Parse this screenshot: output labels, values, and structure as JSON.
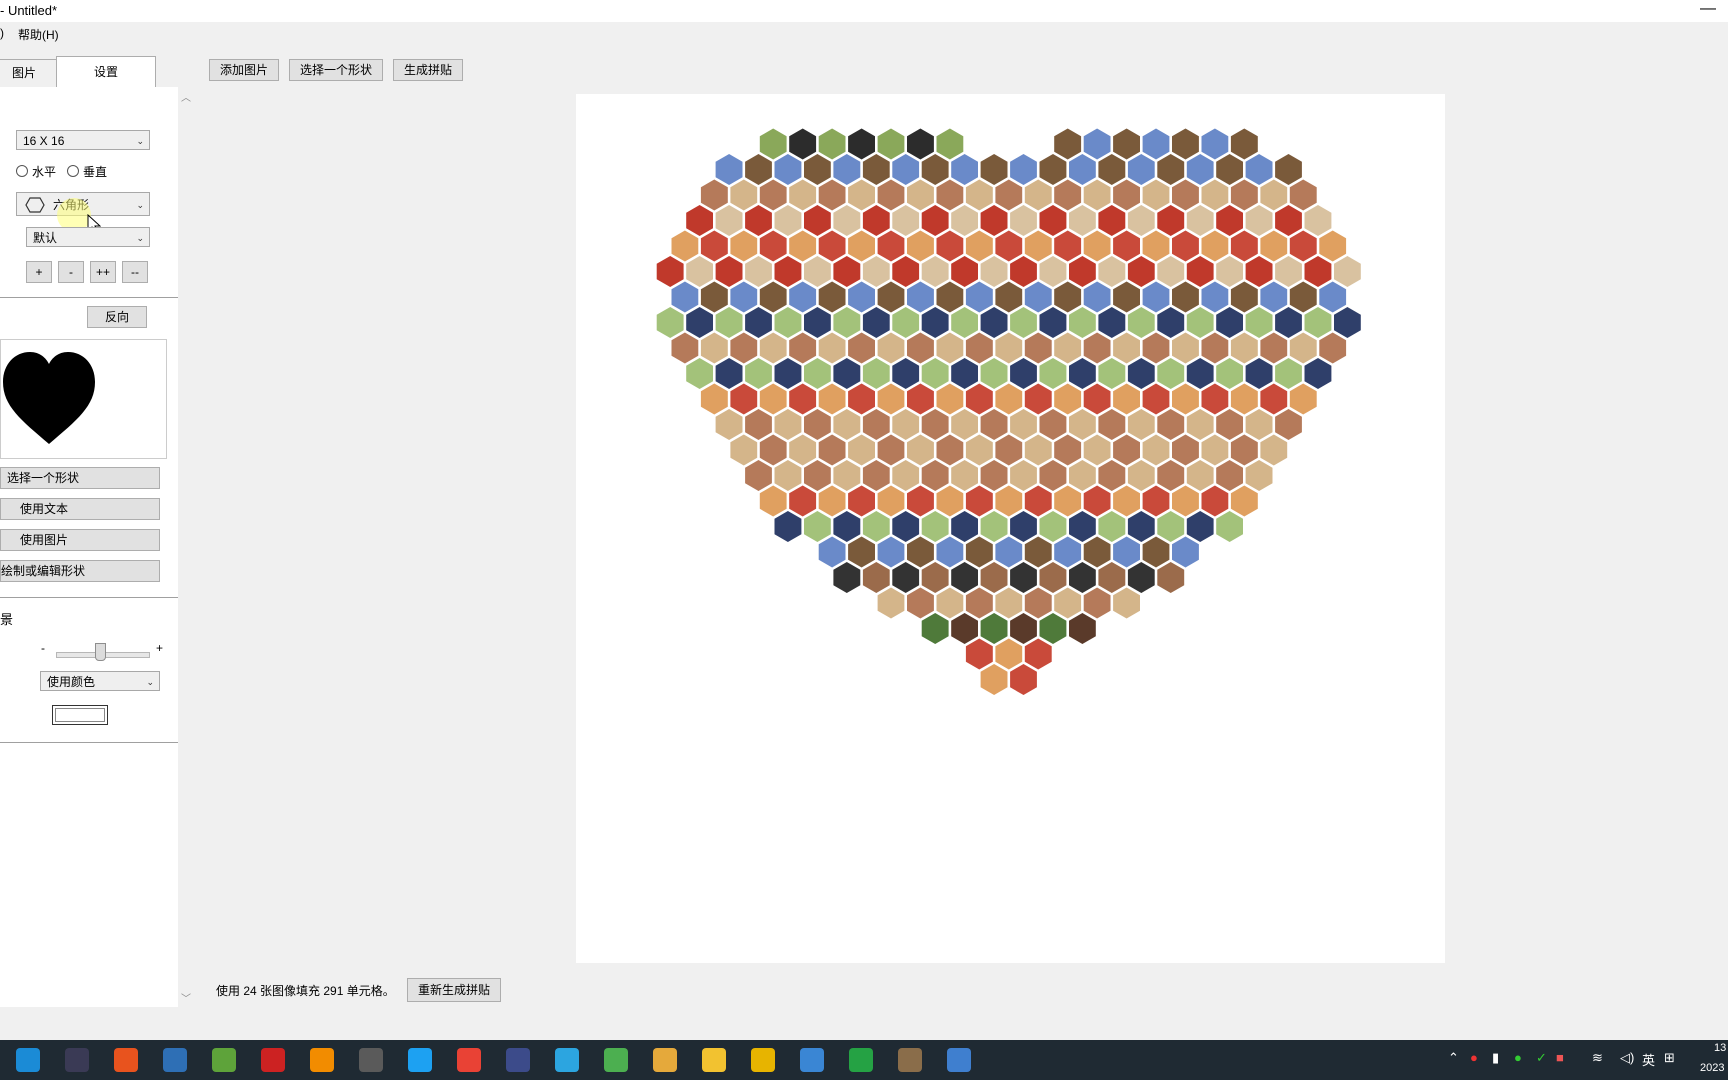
{
  "window": {
    "title": "- Untitled*",
    "minimize_glyph": "—"
  },
  "menu": {
    "items": [
      ")",
      "帮助(H)"
    ]
  },
  "tabs": [
    {
      "label": "图片"
    },
    {
      "label": "设置"
    }
  ],
  "settings": {
    "grid_size": "16 X 16",
    "orientation": {
      "horizontal": "水平",
      "vertical": "垂直"
    },
    "cell_shape": "六角形",
    "style": "默认",
    "size_buttons": [
      "+",
      "-",
      "++",
      "--"
    ],
    "reverse_label": "反向",
    "shape_buttons": [
      "选择一个形状",
      "使用文本",
      "使用图片",
      "绘制或编辑形状"
    ],
    "background_label": "景",
    "slider": {
      "minus": "-",
      "plus": "+",
      "level": 0.5
    },
    "fill_mode": "使用颜色",
    "background_color": "#ffffff"
  },
  "toolbar": {
    "add_images": "添加图片",
    "choose_shape": "选择一个形状",
    "generate": "生成拼贴"
  },
  "canvas": {
    "shape": "heart",
    "cell": "hexagon",
    "hex_cells": 291
  },
  "status": {
    "text": "使用 24 张图像填充 291 单元格。",
    "regenerate": "重新生成拼贴"
  },
  "taskbar": {
    "tray_ime": "英",
    "time": "13",
    "date": "2023",
    "app_colors": [
      "#1b8bd6",
      "#3a3a55",
      "#e8531e",
      "#2e6fb5",
      "#5ea33a",
      "#cc2222",
      "#f28c00",
      "#5a5a5a",
      "#1da1f2",
      "#e94235",
      "#3c4b8a",
      "#2ca5e0",
      "#4caf50",
      "#e5a93b",
      "#f2c230",
      "#e7b400",
      "#3a86d4",
      "#25a244",
      "#8a6d4a",
      "#3f7fcf"
    ]
  }
}
